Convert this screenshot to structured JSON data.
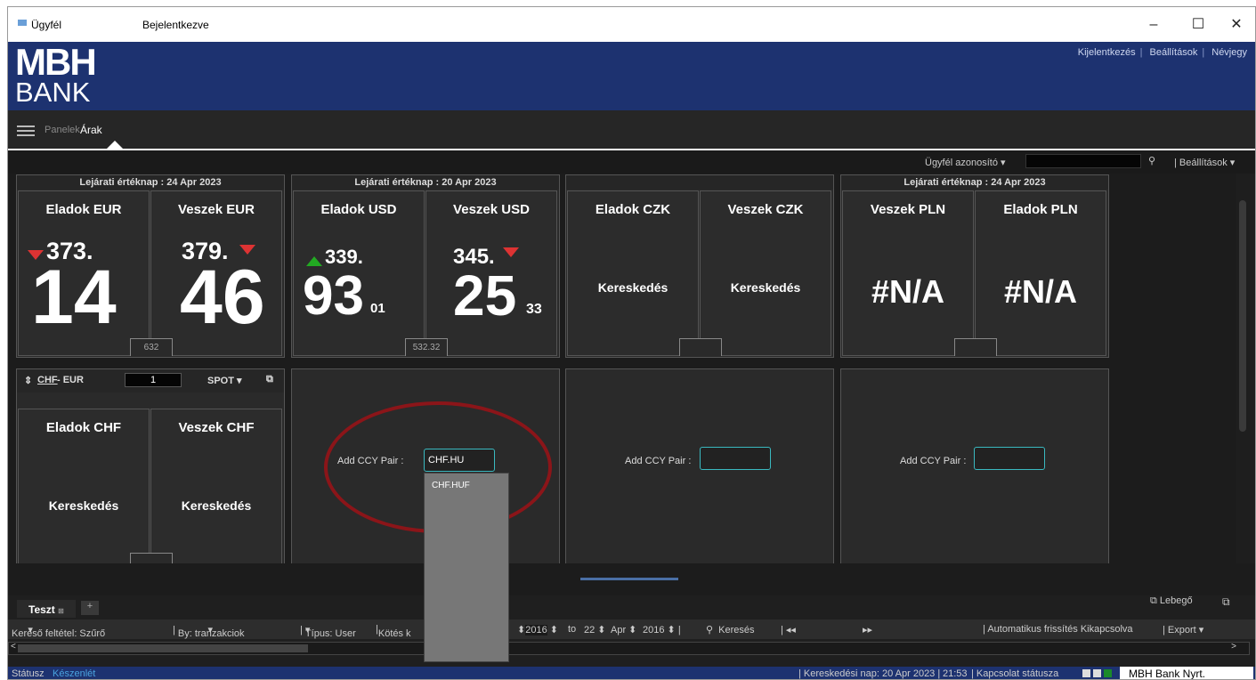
{
  "window": {
    "app_name": "Ügyfél",
    "status": "Bejelentkezve",
    "controls": [
      "–",
      "☐",
      "✕"
    ]
  },
  "brand": {
    "logo_top": "MBH",
    "logo_bottom": "BANK"
  },
  "top_links": [
    "Kijelentkezés",
    "Beállítások",
    "Névjegy"
  ],
  "nav": {
    "panelek": "Panelek",
    "arak": "Árak"
  },
  "filter": {
    "client_id_label": "Ügyfél azonosító",
    "settings": "Beállítások"
  },
  "tiles": [
    {
      "header": "Lejárati értéknap : 24 Apr 2023",
      "left": {
        "label": "Eladok EUR",
        "prefix": "373.",
        "big": "14",
        "dir": "down"
      },
      "right": {
        "label": "Veszek EUR",
        "prefix": "379.",
        "big": "46",
        "dir": "down"
      },
      "spread": "632"
    },
    {
      "header": "Lejárati értéknap : 20 Apr 2023",
      "left": {
        "label": "Eladok USD",
        "prefix": "339.",
        "big": "93",
        "sub": "01",
        "dir": "up"
      },
      "right": {
        "label": "Veszek USD",
        "prefix": "345.",
        "big": "25",
        "sub": "33",
        "dir": "down"
      },
      "spread": "532.32"
    },
    {
      "header": "",
      "left": {
        "label": "Eladok CZK",
        "mid": "Kereskedés"
      },
      "right": {
        "label": "Veszek CZK",
        "mid": "Kereskedés"
      },
      "spread": ""
    },
    {
      "header": "Lejárati értéknap : 24 Apr 2023",
      "left": {
        "label": "Veszek PLN",
        "na": "#N/A"
      },
      "right": {
        "label": "Eladok PLN",
        "na": "#N/A"
      },
      "spread": ""
    }
  ],
  "chf_tile": {
    "pair_base": "CHF",
    "pair_rest": " - EUR",
    "amount": "1",
    "type": "SPOT",
    "left": {
      "label": "Eladok CHF",
      "mid": "Kereskedés"
    },
    "right": {
      "label": "Veszek CHF",
      "mid": "Kereskedés"
    }
  },
  "add_ccy": {
    "label": "Add CCY Pair :",
    "active_value": "CHF.HU",
    "suggestion": "CHF.HUF"
  },
  "bottom": {
    "tab": "Teszt",
    "plus": "+",
    "lebego": "Lebegő"
  },
  "toolbar": {
    "kereso": "Kereső feltétel: Szűrő",
    "by": "By: tranzakciok",
    "tipus": "Típus: User",
    "kotes": "Kötés k",
    "year1": "2016",
    "to": "to",
    "day2": "22",
    "month2": "Apr",
    "year2": "2016",
    "kereses": "Keresés",
    "auto": "Automatikus frissítés Kikapcsolva",
    "export": "Export"
  },
  "status": {
    "label": "Státusz",
    "value": "Készenlét",
    "tradeday": "Kereskedési nap: 20 Apr 2023",
    "time": "21:53",
    "conn": "Kapcsolat státusza",
    "brand": "MBH Bank Nyrt."
  },
  "colors": {
    "banner": "#1d3270",
    "down": "#dd3333",
    "up": "#22aa22",
    "circle": "#8b1519"
  }
}
